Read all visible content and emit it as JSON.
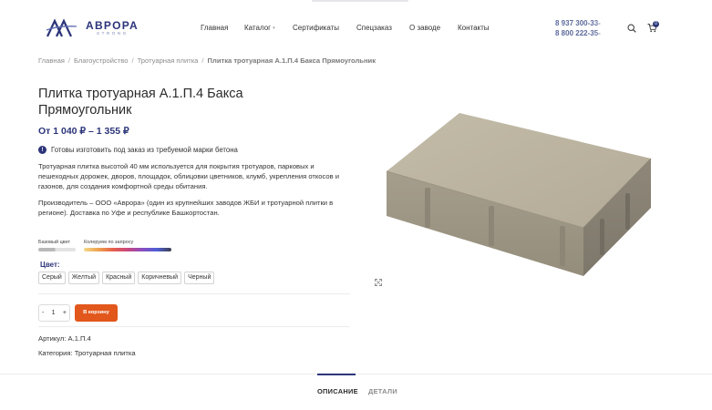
{
  "header": {
    "logo": {
      "name": "АВРОРА",
      "tagline": "STRONG"
    },
    "nav": [
      {
        "label": "Главная"
      },
      {
        "label": "Каталог",
        "has_dropdown": true
      },
      {
        "label": "Сертификаты"
      },
      {
        "label": "Спецзаказ"
      },
      {
        "label": "О заводе"
      },
      {
        "label": "Контакты"
      }
    ],
    "phones": [
      "8 937 300-33-",
      "8 800 222-35-"
    ],
    "cart_count": "0"
  },
  "breadcrumb": {
    "items": [
      "Главная",
      "Благоустройство",
      "Тротуарная плитка"
    ],
    "current": "Плитка тротуарная А.1.П.4 Бакса Прямоугольник",
    "separator": "/"
  },
  "product": {
    "title": "Плитка тротуарная А.1.П.4 Бакса Прямоугольник",
    "price": "От 1 040 ₽ – 1 355 ₽",
    "notice": "Готовы изготовить под заказ из требуемой марки бетона",
    "notice_icon": "!",
    "description_1": "Тротуарная плитка высотой 40 мм используется для покрытия тротуаров, парковых и пешеходных дорожек, дворов, площадок, облицовки цветников,  клумб, укрепления откосов и газонов, для создания комфортной среды обитания.",
    "description_2": "Производитель – ООО «Аврора» (один из крупнейших заводов ЖБИ и тротуарной плитки в регионе). Доставка по Уфе и республике Башкортостан.",
    "swatch_base_label": "Базовый цвет",
    "swatch_color_label": "Колеруем по запросу",
    "color_label": "Цвет:",
    "colors": [
      "Серый",
      "Желтый",
      "Красный",
      "Коричневый",
      "Черный"
    ],
    "quantity": {
      "minus": "-",
      "value": "1",
      "plus": "+"
    },
    "add_to_cart": "В корзину",
    "sku_label": "Артикул:",
    "sku": "А.1.П.4",
    "category_label": "Категория:",
    "category": "Тротуарная плитка"
  },
  "tabs": [
    {
      "label": "ОПИСАНИЕ",
      "active": true
    },
    {
      "label": "ДЕТАЛИ",
      "active": false
    }
  ],
  "colors": {
    "brand": "#2c3579",
    "accent": "#e2571b",
    "phone": "#5c6a9c"
  }
}
